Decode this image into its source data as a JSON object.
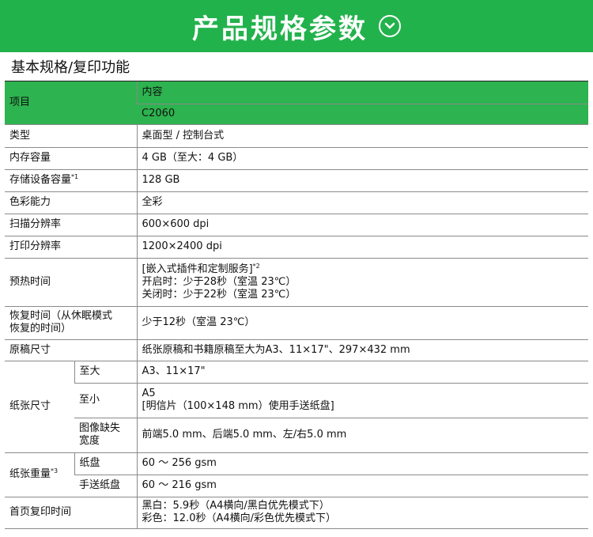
{
  "banner": {
    "title": "产品规格参数",
    "icon": "chevron-down-circle-icon"
  },
  "section": {
    "title": "基本规格/复印功能"
  },
  "table": {
    "header_item": "项目",
    "header_content": "内容",
    "header_model": "C2060",
    "rows": {
      "type": {
        "label": "类型",
        "value": "桌面型 / 控制台式"
      },
      "memory": {
        "label": "内存容量",
        "value": "4 GB（至大：4 GB）"
      },
      "storage": {
        "label": "存储设备容量",
        "note": "*1",
        "value": "128 GB"
      },
      "color": {
        "label": "色彩能力",
        "value": "全彩"
      },
      "scan_res": {
        "label": "扫描分辨率",
        "value": "600×600 dpi"
      },
      "print_res": {
        "label": "打印分辨率",
        "value": "1200×2400 dpi"
      },
      "warmup": {
        "label": "预热时间",
        "line1": "[嵌入式插件和定制服务]",
        "line1_note": "*2",
        "line2": "开启时：少于28秒（室温 23℃）",
        "line3": "关闭时：少于22秒（室温 23℃）"
      },
      "recovery": {
        "label_line1": "恢复时间（从休眠模式",
        "label_line2": "恢复的时间）",
        "value": "少于12秒（室温 23℃）"
      },
      "original": {
        "label": "原稿尺寸",
        "value": "纸张原稿和书籍原稿至大为A3、11×17\"、297×432 mm"
      },
      "paper_size": {
        "label": "纸张尺寸",
        "max_label": "至大",
        "max_value": "A3、11×17\"",
        "min_label": "至小",
        "min_value_line1": "A5",
        "min_value_line2": "[明信片（100×148 mm）使用手送纸盘]",
        "loss_label_line1": "图像缺失",
        "loss_label_line2": "宽度",
        "loss_value": "前端5.0 mm、后端5.0 mm、左/右5.0 mm"
      },
      "paper_weight": {
        "label": "纸张重量",
        "note": "*3",
        "tray_label": "纸盘",
        "tray_value": "60 ～ 256 gsm",
        "bypass_label": "手送纸盘",
        "bypass_value": "60 ～ 216 gsm"
      },
      "first_copy": {
        "label": "首页复印时间",
        "line1": "黑白：5.9秒（A4横向/黑白优先模式下）",
        "line2": "彩色：12.0秒（A4横向/彩色优先模式下）"
      }
    }
  },
  "colors": {
    "banner": "#22b24c",
    "header": "#2db34f"
  }
}
